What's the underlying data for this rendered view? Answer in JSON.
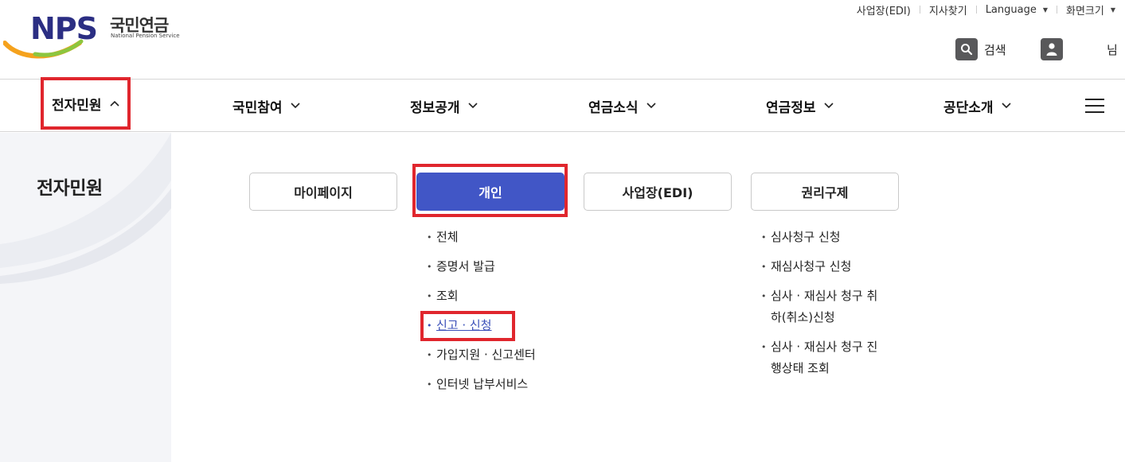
{
  "logo": {
    "brand": "NPS",
    "name_ko": "국민연금",
    "name_en": "National Pension Service"
  },
  "util_nav": [
    {
      "label": "사업장(EDI)",
      "caret": false
    },
    {
      "label": "지사찾기",
      "caret": false
    },
    {
      "label": "Language",
      "caret": true
    },
    {
      "label": "화면크기",
      "caret": true
    }
  ],
  "header": {
    "search_label": "검색",
    "user_suffix": "님"
  },
  "gnb": [
    {
      "label": "전자민원",
      "expanded": true
    },
    {
      "label": "국민참여",
      "expanded": false
    },
    {
      "label": "정보공개",
      "expanded": false
    },
    {
      "label": "연금소식",
      "expanded": false
    },
    {
      "label": "연금정보",
      "expanded": false
    },
    {
      "label": "공단소개",
      "expanded": false
    }
  ],
  "aside": {
    "title": "전자민원"
  },
  "tabs": [
    {
      "label": "마이페이지",
      "active": false
    },
    {
      "label": "개인",
      "active": true
    },
    {
      "label": "사업장(EDI)",
      "active": false
    },
    {
      "label": "권리구제",
      "active": false
    }
  ],
  "personal_menu": [
    "전체",
    "증명서 발급",
    "조회",
    "신고 · 신청",
    "가입지원 · 신고센터",
    "인터넷 납부서비스"
  ],
  "remedy_menu": [
    "심사청구 신청",
    "재심사청구 신청",
    "심사 · 재심사 청구 취하(취소)신청",
    "심사 · 재심사 청구 진행상태 조회"
  ],
  "colors": {
    "accent": "#4156c6",
    "highlight": "#e0262d",
    "brand": "#2b2e83",
    "link": "#3a4fb8"
  }
}
